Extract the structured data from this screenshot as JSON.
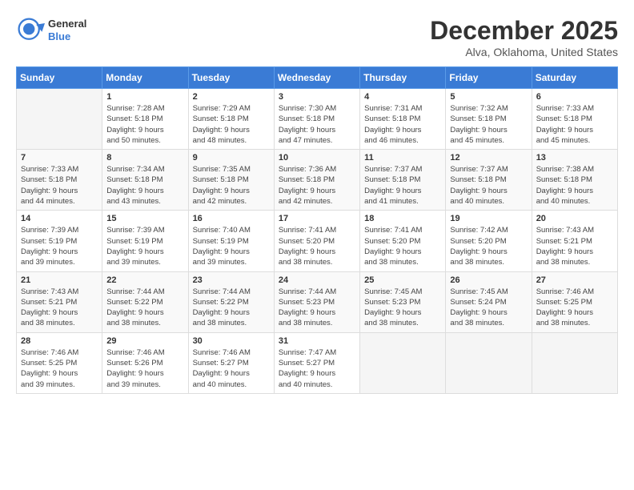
{
  "header": {
    "logo": {
      "general": "General",
      "blue": "Blue"
    },
    "title": "December 2025",
    "location": "Alva, Oklahoma, United States"
  },
  "weekdays": [
    "Sunday",
    "Monday",
    "Tuesday",
    "Wednesday",
    "Thursday",
    "Friday",
    "Saturday"
  ],
  "weeks": [
    [
      {
        "day": null,
        "info": null
      },
      {
        "day": "1",
        "info": "Sunrise: 7:28 AM\nSunset: 5:18 PM\nDaylight: 9 hours\nand 50 minutes."
      },
      {
        "day": "2",
        "info": "Sunrise: 7:29 AM\nSunset: 5:18 PM\nDaylight: 9 hours\nand 48 minutes."
      },
      {
        "day": "3",
        "info": "Sunrise: 7:30 AM\nSunset: 5:18 PM\nDaylight: 9 hours\nand 47 minutes."
      },
      {
        "day": "4",
        "info": "Sunrise: 7:31 AM\nSunset: 5:18 PM\nDaylight: 9 hours\nand 46 minutes."
      },
      {
        "day": "5",
        "info": "Sunrise: 7:32 AM\nSunset: 5:18 PM\nDaylight: 9 hours\nand 45 minutes."
      },
      {
        "day": "6",
        "info": "Sunrise: 7:33 AM\nSunset: 5:18 PM\nDaylight: 9 hours\nand 45 minutes."
      }
    ],
    [
      {
        "day": "7",
        "info": "Sunrise: 7:33 AM\nSunset: 5:18 PM\nDaylight: 9 hours\nand 44 minutes."
      },
      {
        "day": "8",
        "info": "Sunrise: 7:34 AM\nSunset: 5:18 PM\nDaylight: 9 hours\nand 43 minutes."
      },
      {
        "day": "9",
        "info": "Sunrise: 7:35 AM\nSunset: 5:18 PM\nDaylight: 9 hours\nand 42 minutes."
      },
      {
        "day": "10",
        "info": "Sunrise: 7:36 AM\nSunset: 5:18 PM\nDaylight: 9 hours\nand 42 minutes."
      },
      {
        "day": "11",
        "info": "Sunrise: 7:37 AM\nSunset: 5:18 PM\nDaylight: 9 hours\nand 41 minutes."
      },
      {
        "day": "12",
        "info": "Sunrise: 7:37 AM\nSunset: 5:18 PM\nDaylight: 9 hours\nand 40 minutes."
      },
      {
        "day": "13",
        "info": "Sunrise: 7:38 AM\nSunset: 5:18 PM\nDaylight: 9 hours\nand 40 minutes."
      }
    ],
    [
      {
        "day": "14",
        "info": "Sunrise: 7:39 AM\nSunset: 5:19 PM\nDaylight: 9 hours\nand 39 minutes."
      },
      {
        "day": "15",
        "info": "Sunrise: 7:39 AM\nSunset: 5:19 PM\nDaylight: 9 hours\nand 39 minutes."
      },
      {
        "day": "16",
        "info": "Sunrise: 7:40 AM\nSunset: 5:19 PM\nDaylight: 9 hours\nand 39 minutes."
      },
      {
        "day": "17",
        "info": "Sunrise: 7:41 AM\nSunset: 5:20 PM\nDaylight: 9 hours\nand 38 minutes."
      },
      {
        "day": "18",
        "info": "Sunrise: 7:41 AM\nSunset: 5:20 PM\nDaylight: 9 hours\nand 38 minutes."
      },
      {
        "day": "19",
        "info": "Sunrise: 7:42 AM\nSunset: 5:20 PM\nDaylight: 9 hours\nand 38 minutes."
      },
      {
        "day": "20",
        "info": "Sunrise: 7:43 AM\nSunset: 5:21 PM\nDaylight: 9 hours\nand 38 minutes."
      }
    ],
    [
      {
        "day": "21",
        "info": "Sunrise: 7:43 AM\nSunset: 5:21 PM\nDaylight: 9 hours\nand 38 minutes."
      },
      {
        "day": "22",
        "info": "Sunrise: 7:44 AM\nSunset: 5:22 PM\nDaylight: 9 hours\nand 38 minutes."
      },
      {
        "day": "23",
        "info": "Sunrise: 7:44 AM\nSunset: 5:22 PM\nDaylight: 9 hours\nand 38 minutes."
      },
      {
        "day": "24",
        "info": "Sunrise: 7:44 AM\nSunset: 5:23 PM\nDaylight: 9 hours\nand 38 minutes."
      },
      {
        "day": "25",
        "info": "Sunrise: 7:45 AM\nSunset: 5:23 PM\nDaylight: 9 hours\nand 38 minutes."
      },
      {
        "day": "26",
        "info": "Sunrise: 7:45 AM\nSunset: 5:24 PM\nDaylight: 9 hours\nand 38 minutes."
      },
      {
        "day": "27",
        "info": "Sunrise: 7:46 AM\nSunset: 5:25 PM\nDaylight: 9 hours\nand 38 minutes."
      }
    ],
    [
      {
        "day": "28",
        "info": "Sunrise: 7:46 AM\nSunset: 5:25 PM\nDaylight: 9 hours\nand 39 minutes."
      },
      {
        "day": "29",
        "info": "Sunrise: 7:46 AM\nSunset: 5:26 PM\nDaylight: 9 hours\nand 39 minutes."
      },
      {
        "day": "30",
        "info": "Sunrise: 7:46 AM\nSunset: 5:27 PM\nDaylight: 9 hours\nand 40 minutes."
      },
      {
        "day": "31",
        "info": "Sunrise: 7:47 AM\nSunset: 5:27 PM\nDaylight: 9 hours\nand 40 minutes."
      },
      {
        "day": null,
        "info": null
      },
      {
        "day": null,
        "info": null
      },
      {
        "day": null,
        "info": null
      }
    ]
  ]
}
